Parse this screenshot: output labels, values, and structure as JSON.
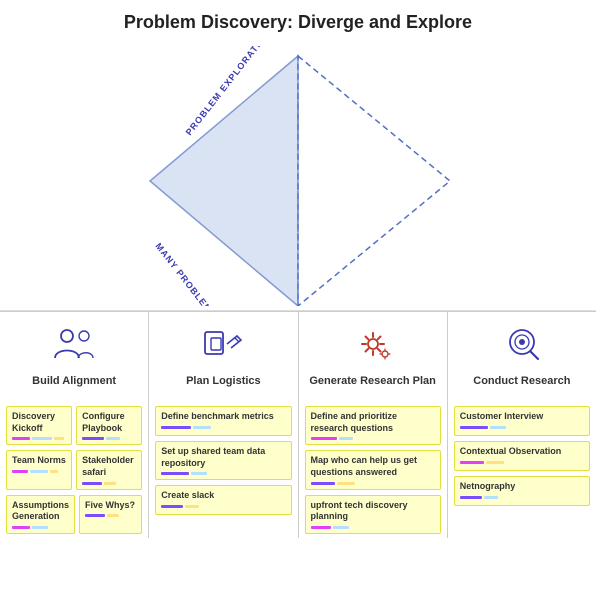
{
  "page": {
    "title": "Problem Discovery: Diverge and Explore"
  },
  "diamond": {
    "label_top": "PROBLEM EXPLORATION",
    "label_bottom": "MANY PROBLEMS"
  },
  "columns": [
    {
      "id": "build-alignment",
      "icon": "people",
      "label": "Build Alignment",
      "cards_row1": [
        {
          "text": "Discovery Kickoff",
          "bars": [
            {
              "color": "#e040fb",
              "w": 18
            },
            {
              "color": "#b3e0ff",
              "w": 20
            },
            {
              "color": "#ffe082",
              "w": 10
            }
          ]
        },
        {
          "text": "Configure Playbook",
          "bars": [
            {
              "color": "#7c4dff",
              "w": 22
            },
            {
              "color": "#b3e0ff",
              "w": 14
            }
          ]
        }
      ],
      "cards_row2": [
        {
          "text": "Team Norms",
          "bars": [
            {
              "color": "#e040fb",
              "w": 16
            },
            {
              "color": "#b3e0ff",
              "w": 18
            },
            {
              "color": "#ffe082",
              "w": 8
            }
          ]
        },
        {
          "text": "Stakeholder safari",
          "bars": [
            {
              "color": "#7c4dff",
              "w": 20
            },
            {
              "color": "#ffe082",
              "w": 12
            }
          ]
        }
      ],
      "cards_row3": [
        {
          "text": "Assumptions Generation",
          "bars": [
            {
              "color": "#e040fb",
              "w": 18
            },
            {
              "color": "#b3e0ff",
              "w": 16
            }
          ]
        },
        {
          "text": "Five Whys?",
          "bars": [
            {
              "color": "#7c4dff",
              "w": 20
            },
            {
              "color": "#ffe082",
              "w": 12
            }
          ]
        }
      ]
    },
    {
      "id": "plan-logistics",
      "icon": "plan",
      "label": "Plan Logistics",
      "cards": [
        {
          "text": "Define benchmark metrics",
          "bars": [
            {
              "color": "#7c4dff",
              "w": 30
            },
            {
              "color": "#b3e0ff",
              "w": 18
            }
          ]
        },
        {
          "text": "Set up shared team data repository",
          "bars": [
            {
              "color": "#7c4dff",
              "w": 28
            },
            {
              "color": "#b3e0ff",
              "w": 16
            }
          ]
        },
        {
          "text": "Create slack",
          "bars": [
            {
              "color": "#7c4dff",
              "w": 22
            },
            {
              "color": "#ffe082",
              "w": 14
            }
          ]
        }
      ]
    },
    {
      "id": "generate-research-plan",
      "icon": "gear",
      "label": "Generate Research Plan",
      "cards": [
        {
          "text": "Define and prioritize research questions",
          "bars": [
            {
              "color": "#e040fb",
              "w": 26
            },
            {
              "color": "#b3e0ff",
              "w": 14
            }
          ]
        },
        {
          "text": "Map who can help us get questions answered",
          "bars": [
            {
              "color": "#7c4dff",
              "w": 24
            },
            {
              "color": "#ffe082",
              "w": 18
            }
          ]
        },
        {
          "text": "upfront tech discovery planning",
          "bars": [
            {
              "color": "#e040fb",
              "w": 20
            },
            {
              "color": "#b3e0ff",
              "w": 16
            }
          ]
        }
      ]
    },
    {
      "id": "conduct-research",
      "icon": "magnify",
      "label": "Conduct Research",
      "cards": [
        {
          "text": "Customer Interview",
          "bars": [
            {
              "color": "#7c4dff",
              "w": 28
            },
            {
              "color": "#b3e0ff",
              "w": 16
            }
          ]
        },
        {
          "text": "Contextual Observation",
          "bars": [
            {
              "color": "#e040fb",
              "w": 24
            },
            {
              "color": "#ffe082",
              "w": 18
            }
          ]
        },
        {
          "text": "Netnography",
          "bars": [
            {
              "color": "#7c4dff",
              "w": 22
            },
            {
              "color": "#b3e0ff",
              "w": 14
            }
          ]
        }
      ]
    }
  ]
}
